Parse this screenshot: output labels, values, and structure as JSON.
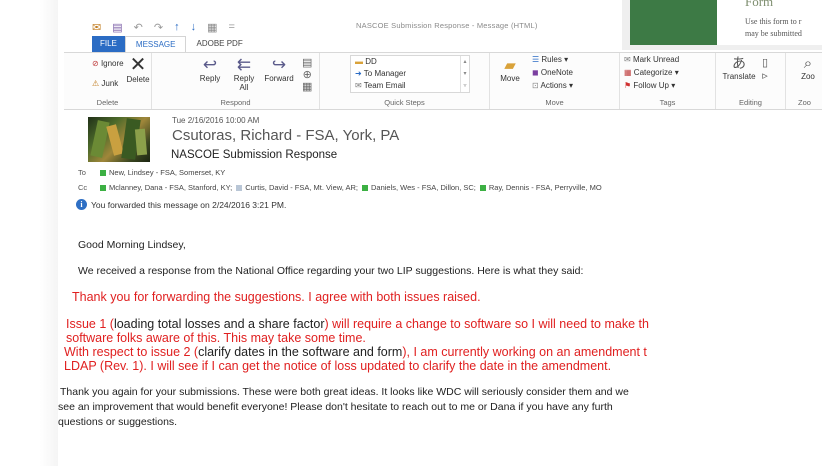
{
  "window": {
    "title": "NASCOE Submission Response - Message (HTML)"
  },
  "overlay_doc": {
    "heading": "Form",
    "line1": "Use this form to r",
    "line2": "may be submitted"
  },
  "tabs": [
    "FILE",
    "MESSAGE",
    "ADOBE PDF"
  ],
  "ribbon": {
    "delete": {
      "ignore": "Ignore",
      "junk": "Junk",
      "delete": "Delete",
      "label": "Delete"
    },
    "respond": {
      "reply": "Reply",
      "reply_all_1": "Reply",
      "reply_all_2": "All",
      "forward": "Forward",
      "label": "Respond"
    },
    "quick_steps": {
      "items": [
        "DD",
        "To Manager",
        "Team Email"
      ],
      "label": "Quick Steps"
    },
    "move": {
      "move": "Move",
      "rules": "Rules",
      "onenote": "OneNote",
      "actions": "Actions",
      "label": "Move"
    },
    "tags": {
      "mark_unread": "Mark Unread",
      "categorize": "Categorize",
      "follow_up": "Follow Up",
      "label": "Tags"
    },
    "editing": {
      "translate": "Translate",
      "label": "Editing"
    },
    "zoom": {
      "zoom": "Zoo",
      "label": "Zoo"
    }
  },
  "message": {
    "date": "Tue 2/16/2016 10:00 AM",
    "sender": "Csutoras, Richard - FSA, York, PA",
    "subject": "NASCOE Submission Response",
    "to_label": "To",
    "to": [
      "New, Lindsey - FSA, Somerset, KY"
    ],
    "cc_label": "Cc",
    "cc": [
      "Mclanney, Dana - FSA, Stanford, KY;",
      "Curtis, David - FSA, Mt. View, AR;",
      "Daniels, Wes - FSA, Dillon, SC;",
      "Ray, Dennis - FSA, Perryville, MO"
    ],
    "forwarded_note": "You forwarded this message on 2/24/2016 3:21 PM."
  },
  "body": {
    "greeting": "Good Morning Lindsey,",
    "intro": "We received a response from the National Office regarding your two LIP suggestions.  Here is what they said:",
    "quote1": "Thank you for forwarding the suggestions.  I agree with both issues raised.",
    "issue1_a": "Issue 1 (",
    "issue1_b": "loading total losses and a share factor",
    "issue1_c": ") will require a change to software so I will need to make th",
    "issue1_line2": "software folks aware of this.  This may take some time.",
    "issue2_a": "With respect to issue 2 (",
    "issue2_b": "clarify dates in the software and form",
    "issue2_c": "), I am currently working on an amendment t",
    "issue2_line2": "LDAP (Rev. 1).  I will see if I can get the notice of loss updated to clarify the date in the amendment.",
    "closing1": "Thank you again for your submissions.  These were both great ideas.  It looks like WDC will seriously consider them and we",
    "closing2": "see an improvement that would benefit everyone!  Please don't hesitate to reach out to me or Dana if you have any furth",
    "closing3": "questions or suggestions."
  },
  "colors": {
    "accent": "#2b6cc4",
    "quote_red": "#e02020",
    "presence_green": "#3cb043"
  }
}
